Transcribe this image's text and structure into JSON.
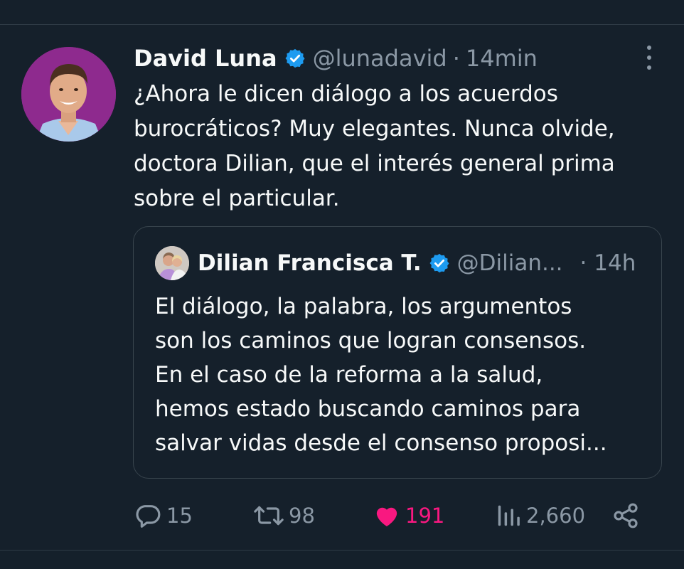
{
  "tweet": {
    "author": {
      "display_name": "David Luna",
      "handle": "@lunadavid",
      "verified": true
    },
    "separator": "·",
    "time": "14min",
    "text_lines": [
      "¿Ahora le dicen diálogo a los acuerdos",
      "burocráticos? Muy elegantes. Nunca olvide,",
      "doctora Dilian, que el interés general prima",
      "sobre el particular."
    ]
  },
  "quote": {
    "author": {
      "display_name": "Dilian Francisca T.",
      "handle": "@Dilian...",
      "verified": true
    },
    "time": "· 14h",
    "text_lines": [
      "El diálogo, la palabra, los argumentos",
      "son los caminos que logran consensos.",
      "En el caso de la reforma a la salud,",
      "hemos estado buscando caminos para",
      "salvar vidas desde el consenso proposi..."
    ]
  },
  "actions": {
    "replies": "15",
    "retweets": "98",
    "likes": "191",
    "views": "2,660"
  },
  "icons": {
    "reply": "reply-icon",
    "retweet": "retweet-icon",
    "like": "heart-icon",
    "views": "views-icon",
    "share": "share-icon",
    "verified": "verified-badge-icon",
    "more": "more-options-icon"
  },
  "colors": {
    "background": "#15202b",
    "text": "#f7f9f9",
    "muted": "#8b98a5",
    "verified": "#1d9bf0",
    "like": "#f91880",
    "border": "#38444d"
  }
}
